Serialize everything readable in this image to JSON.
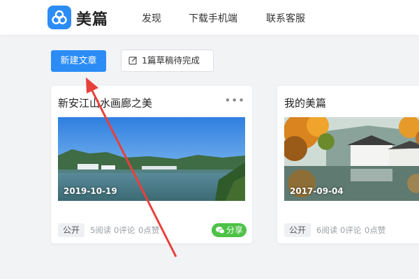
{
  "header": {
    "brand": "美篇",
    "nav": [
      "发现",
      "下载手机端",
      "联系客服"
    ]
  },
  "toolbar": {
    "new_article": "新建文章",
    "drafts": "1篇草稿待完成"
  },
  "articles": [
    {
      "title": "新安江山水画廊之美",
      "date": "2019-10-19",
      "visibility": "公开",
      "reads": "5阅读",
      "comments": "0评论",
      "likes": "0点赞",
      "share": "分享"
    },
    {
      "title": "我的美篇",
      "date": "2017-09-04",
      "visibility": "公开",
      "reads": "6阅读",
      "comments": "0评论",
      "likes": "0点赞"
    }
  ],
  "colors": {
    "accent": "#2b8cf6",
    "share_green": "#4dc247",
    "annotation_arrow": "#e8403a"
  },
  "icons": [
    "app-logo-icon",
    "edit-icon",
    "more-icon",
    "wechat-icon"
  ]
}
